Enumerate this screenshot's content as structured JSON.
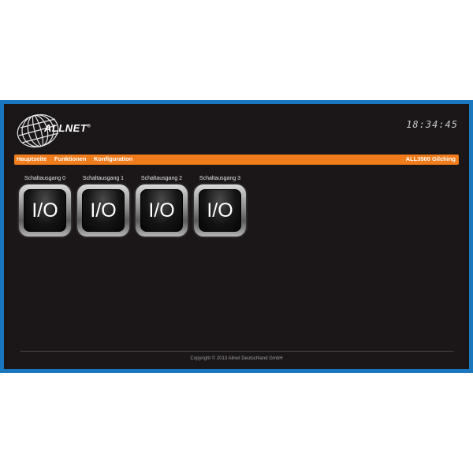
{
  "header": {
    "logo_text": "ALLNET",
    "logo_mark": "®",
    "clock": "18:34:45"
  },
  "nav": {
    "items": [
      {
        "label": "Hauptseite"
      },
      {
        "label": "Funktionen"
      },
      {
        "label": "Konfiguration"
      }
    ],
    "device": "ALL3500 Gilching"
  },
  "switches": [
    {
      "label": "Schaltausgang 0",
      "button": "I/O"
    },
    {
      "label": "Schaltausgang 1",
      "button": "I/O"
    },
    {
      "label": "Schaltausgang 2",
      "button": "I/O"
    },
    {
      "label": "Schaltausgang 3",
      "button": "I/O"
    }
  ],
  "footer": {
    "copyright": "Copyright © 2013 Allnet Deutschland GmbH"
  },
  "colors": {
    "frame": "#1a77bd",
    "background": "#1b1718",
    "nav_accent": "#f07c1b"
  }
}
